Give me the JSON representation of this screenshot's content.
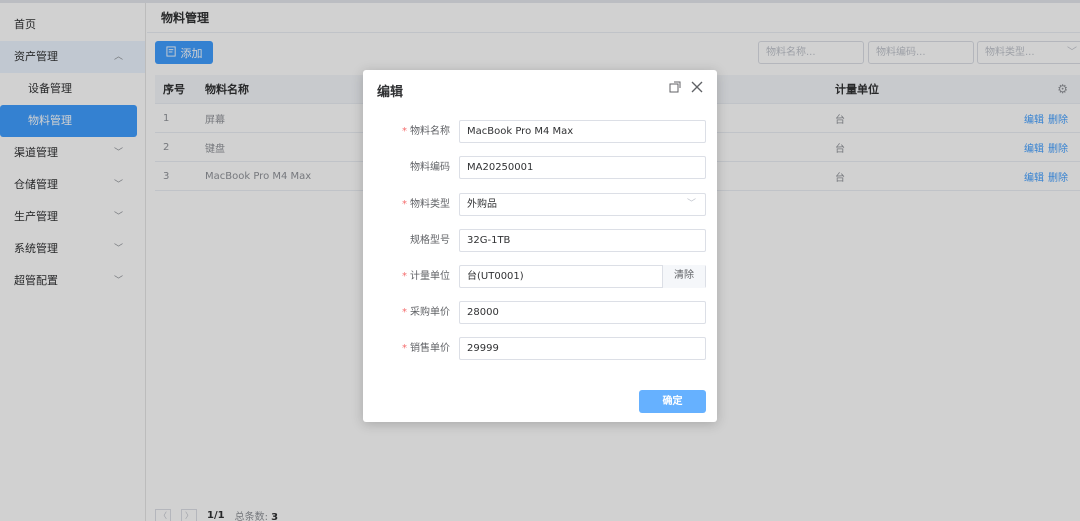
{
  "sidebar": {
    "items": [
      {
        "label": "首页"
      },
      {
        "label": "资产管理",
        "expanded": true
      },
      {
        "label": "设备管理"
      },
      {
        "label": "物料管理",
        "active": true
      },
      {
        "label": "渠道管理"
      },
      {
        "label": "仓储管理"
      },
      {
        "label": "生产管理"
      },
      {
        "label": "系统管理"
      },
      {
        "label": "超管配置"
      }
    ]
  },
  "main": {
    "title": "物料管理",
    "add_label": "添加",
    "filters": [
      "物料名称...",
      "物料编码...",
      "物料类型..."
    ],
    "table": {
      "headers": {
        "no": "序号",
        "name": "物料名称",
        "unit": "计量单位"
      },
      "rows": [
        {
          "no": "1",
          "name": "屏幕",
          "unit": "台",
          "edit": "编辑",
          "delete": "删除"
        },
        {
          "no": "2",
          "name": "键盘",
          "unit": "台",
          "edit": "编辑",
          "delete": "删除"
        },
        {
          "no": "3",
          "name": "MacBook Pro M4 Max",
          "unit": "台",
          "edit": "编辑",
          "delete": "删除"
        }
      ]
    },
    "pager": {
      "page": "1/1",
      "total_label": "总条数:",
      "total": "3"
    }
  },
  "dialog": {
    "title": "编辑",
    "fields": [
      {
        "label": "物料名称",
        "required": true,
        "value": "MacBook Pro M4 Max"
      },
      {
        "label": "物料编码",
        "required": false,
        "value": "MA20250001"
      },
      {
        "label": "物料类型",
        "required": true,
        "value": "外购品"
      },
      {
        "label": "规格型号",
        "required": false,
        "value": "32G-1TB"
      },
      {
        "label": "计量单位",
        "required": true,
        "value": "台(UT0001)"
      },
      {
        "label": "采购单价",
        "required": true,
        "value": "28000"
      },
      {
        "label": "销售单价",
        "required": true,
        "value": "29999"
      }
    ],
    "clear_label": "清除",
    "confirm_label": "确定"
  },
  "colors": {
    "primary": "#409eff",
    "required": "#f56c6c"
  }
}
